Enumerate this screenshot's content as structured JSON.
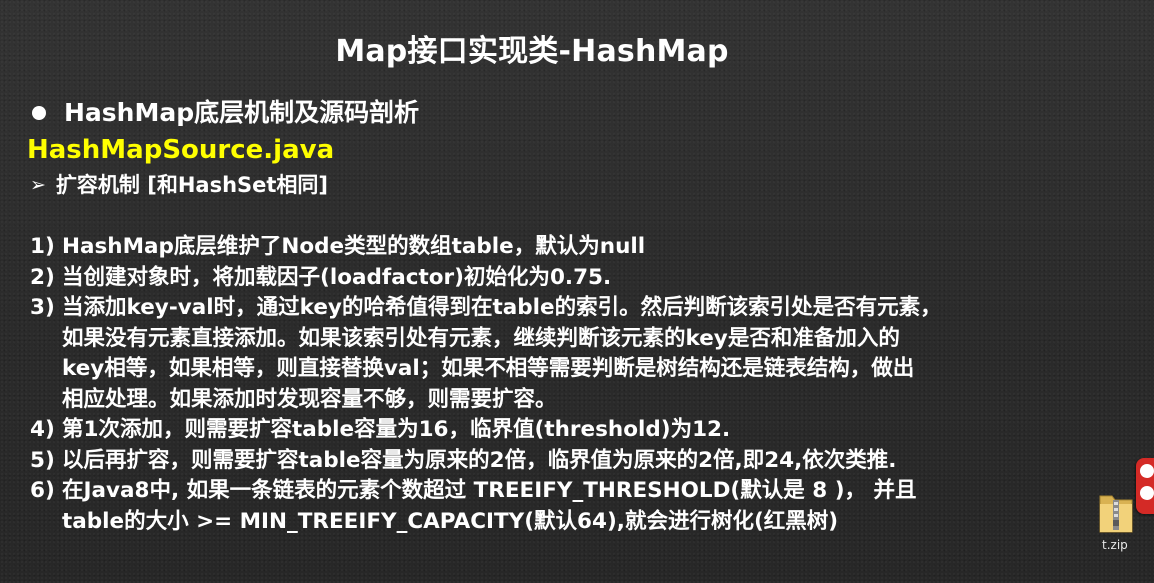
{
  "slide": {
    "title": "Map接口实现类-HashMap",
    "bullet_heading": "HashMap底层机制及源码剖析",
    "source_file": "HashMapSource.java",
    "sub_heading": "扩容机制 [和HashSet相同]",
    "colors": {
      "background": "#2e2e2e",
      "text": "#ffffff",
      "highlight": "#ffff00",
      "widget": "#d42a26"
    },
    "points": [
      {
        "num": "1)",
        "lines": [
          "HashMap底层维护了Node类型的数组table，默认为null"
        ]
      },
      {
        "num": "2)",
        "lines": [
          "当创建对象时，将加载因子(loadfactor)初始化为0.75."
        ]
      },
      {
        "num": "3)",
        "lines": [
          "当添加key-val时，通过key的哈希值得到在table的索引。然后判断该索引处是否有元素，",
          "如果没有元素直接添加。如果该索引处有元素，继续判断该元素的key是否和准备加入的",
          "key相等，如果相等，则直接替换val；如果不相等需要判断是树结构还是链表结构，做出",
          "相应处理。如果添加时发现容量不够，则需要扩容。"
        ]
      },
      {
        "num": "4)",
        "lines": [
          "第1次添加，则需要扩容table容量为16，临界值(threshold)为12."
        ]
      },
      {
        "num": "5)",
        "lines": [
          "以后再扩容，则需要扩容table容量为原来的2倍，临界值为原来的2倍,即24,依次类推."
        ]
      },
      {
        "num": "6)",
        "lines": [
          "在Java8中, 如果一条链表的元素个数超过 TREEIFY_THRESHOLD(默认是 8 )， 并且",
          "table的大小 >= MIN_TREEIFY_CAPACITY(默认64),就会进行树化(红黑树)"
        ]
      }
    ]
  },
  "desktop": {
    "zip_label": "t.zip",
    "icons": [
      "side-widget-icon",
      "folder-zip-icon"
    ]
  }
}
